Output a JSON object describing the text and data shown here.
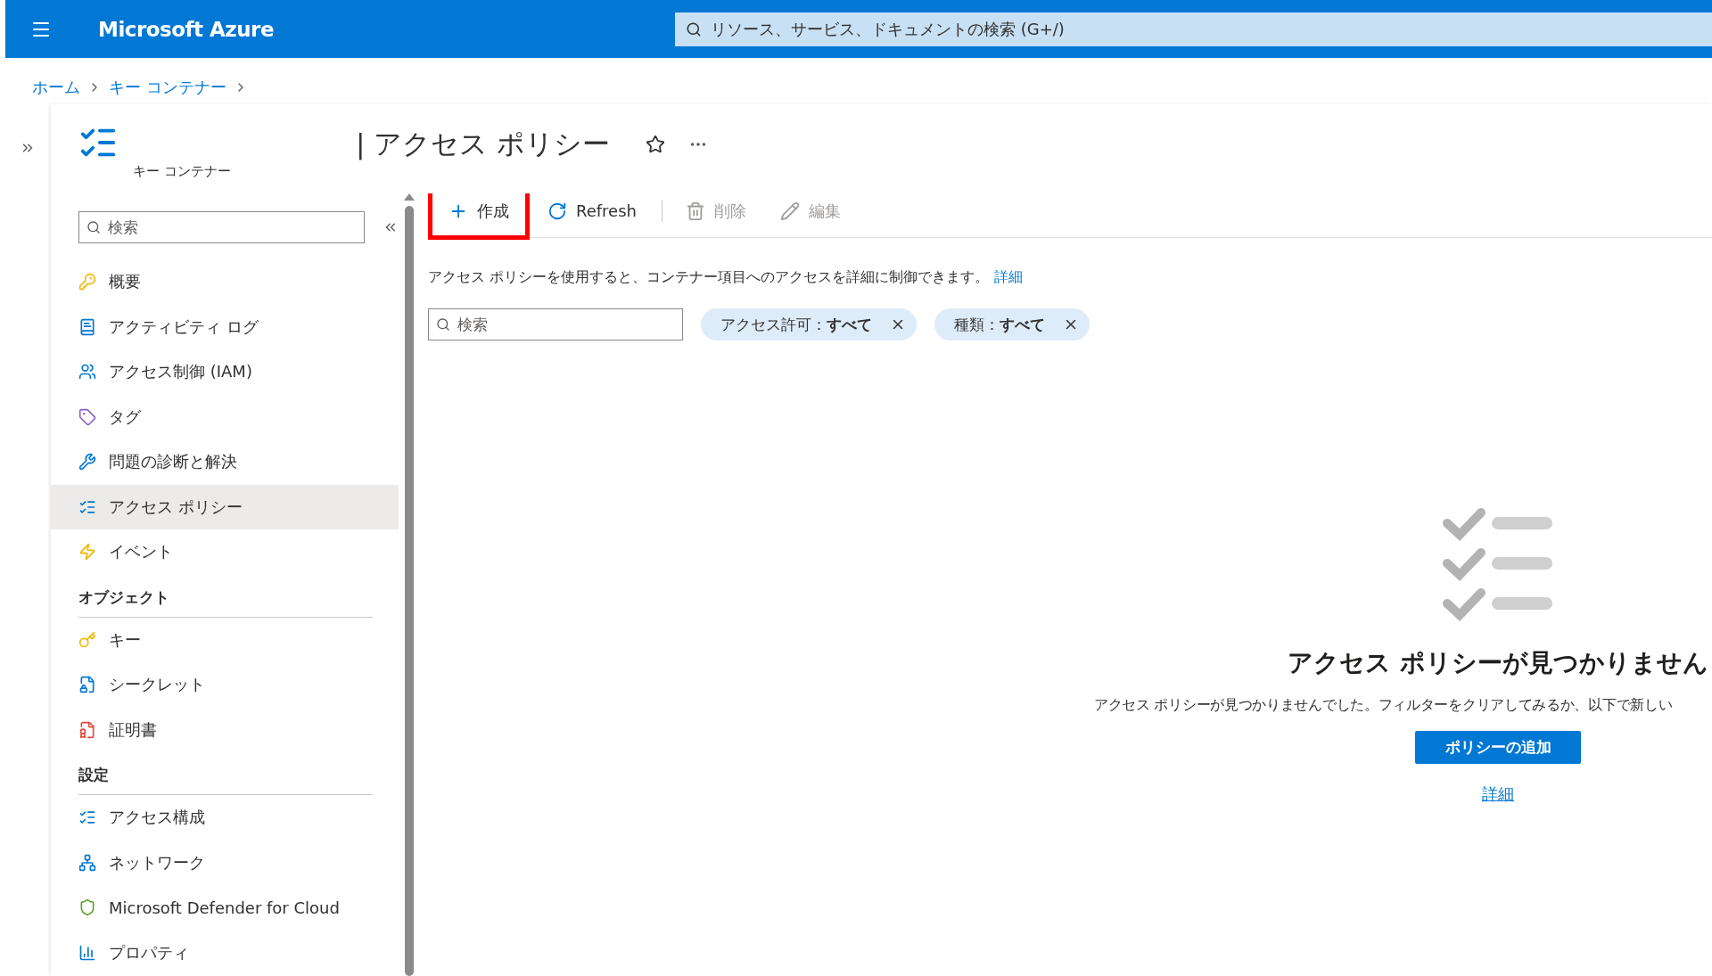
{
  "header": {
    "brand": "Microsoft Azure",
    "search": {
      "placeholder": "リソース、サービス、ドキュメントの検索 (G+/)"
    }
  },
  "breadcrumb": [
    "ホーム",
    "キー コンテナー"
  ],
  "blade": {
    "title": "| アクセス ポリシー",
    "subtitle": "キー コンテナー"
  },
  "sidebar": {
    "search": {
      "placeholder": "検索"
    },
    "sections": [
      {
        "items": [
          {
            "label": "概要",
            "selected": false
          },
          {
            "label": "アクティビティ ログ",
            "selected": false
          },
          {
            "label": "アクセス制御 (IAM)",
            "selected": false
          },
          {
            "label": "タグ",
            "selected": false
          },
          {
            "label": "問題の診断と解決",
            "selected": false
          },
          {
            "label": "アクセス ポリシー",
            "selected": true
          },
          {
            "label": "イベント",
            "selected": false
          }
        ]
      },
      {
        "heading": "オブジェクト",
        "items": [
          {
            "label": "キー",
            "selected": false
          },
          {
            "label": "シークレット",
            "selected": false
          },
          {
            "label": "証明書",
            "selected": false
          }
        ]
      },
      {
        "heading": "設定",
        "items": [
          {
            "label": "アクセス構成",
            "selected": false
          },
          {
            "label": "ネットワーク",
            "selected": false
          },
          {
            "label": "Microsoft Defender for Cloud",
            "selected": false
          },
          {
            "label": "プロパティ",
            "selected": false
          }
        ]
      }
    ]
  },
  "toolbar": [
    {
      "kind": "create",
      "label": "作成",
      "disabled": false,
      "highlighted": true
    },
    {
      "kind": "refresh",
      "label": "Refresh",
      "disabled": false,
      "highlighted": false
    },
    {
      "kind": "delete",
      "label": "削除",
      "disabled": true,
      "highlighted": false
    },
    {
      "kind": "edit",
      "label": "編集",
      "disabled": true,
      "highlighted": false
    }
  ],
  "description": {
    "text": "アクセス ポリシーを使用すると、コンテナー項目へのアクセスを詳細に制御できます。",
    "link": "詳細"
  },
  "filters": {
    "search": {
      "placeholder": "検索"
    },
    "chips": [
      "アクセス許可：**すべて**",
      "種類：**すべて**"
    ]
  },
  "empty_state": {
    "title": "アクセス ポリシーが見つかりません",
    "message": "アクセス ポリシーが見つかりませんでした。フィルターをクリアしてみるか、以下で新しい",
    "button": "ポリシーの追加",
    "link": "詳細"
  }
}
